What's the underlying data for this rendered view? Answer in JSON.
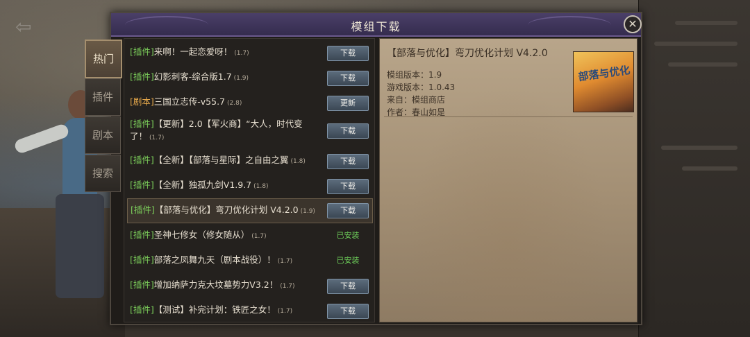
{
  "dialog": {
    "title": "模组下载",
    "close_label": "✕"
  },
  "tabs": [
    {
      "label": "热门",
      "active": true
    },
    {
      "label": "插件",
      "active": false
    },
    {
      "label": "剧本",
      "active": false
    },
    {
      "label": "搜索",
      "active": false
    }
  ],
  "mods": [
    {
      "tag": "[插件]",
      "name": "来啊！一起恋爱呀！",
      "version": "(1.7)",
      "action": "下载"
    },
    {
      "tag": "[插件]",
      "name": "幻影刺客-综合版1.7",
      "version": "(1.9)",
      "action": "下载"
    },
    {
      "tag": "[剧本]",
      "name": "三国立志传-v55.7",
      "version": "(2.8)",
      "action": "更新"
    },
    {
      "tag": "[插件]",
      "name": "【更新】2.0【军火商】“大人，时代变了！",
      "version": "(1.7)",
      "action": "下载"
    },
    {
      "tag": "[插件]",
      "name": "【全新】【部落与星际】之自由之翼",
      "version": "(1.8)",
      "action": "下载"
    },
    {
      "tag": "[插件]",
      "name": "【全新】独孤九剑V1.9.7",
      "version": "(1.8)",
      "action": "下载"
    },
    {
      "tag": "[插件]",
      "name": "【部落与优化】弯刀优化计划 V4.2.0",
      "version": "(1.9)",
      "action": "下载"
    },
    {
      "tag": "[插件]",
      "name": "圣神七修女（修女随从）",
      "version": "(1.7)",
      "action": "已安装"
    },
    {
      "tag": "[插件]",
      "name": "部落之凤舞九天（剧本战役）！",
      "version": "(1.7)",
      "action": "已安装"
    },
    {
      "tag": "[插件]",
      "name": "增加纳萨力克大坟墓势力V3.2！",
      "version": "(1.7)",
      "action": "下载"
    },
    {
      "tag": "[插件]",
      "name": "【测试】补完计划：铁匠之女！",
      "version": "(1.7)",
      "action": "下载"
    }
  ],
  "detail": {
    "title": "【部落与优化】弯刀优化计划 V4.2.0",
    "mod_version": "模组版本：1.9",
    "game_version": "游戏版本：1.0.43",
    "source": "来自：模组商店",
    "author": "作者：春山如是",
    "thumbnail_text": "部落与优化"
  }
}
